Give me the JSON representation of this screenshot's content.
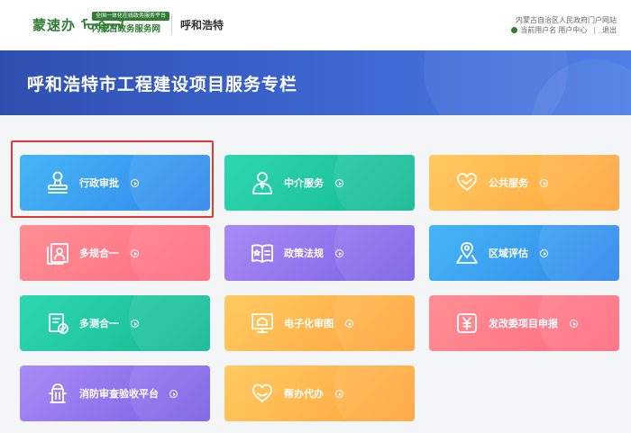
{
  "header": {
    "logo_script": "蒙速办 ᠮᠣᠩᠭᠣᠯ",
    "logo_tag": "全国一体化在线政务服务平台",
    "logo_name": "内蒙古政务服务网",
    "city": "呼和浩特",
    "portal_link": "内蒙古自治区人民政府门户网站",
    "user_label": "当前用户名",
    "user_center": "用户中心",
    "separator": "|",
    "logout": "退出"
  },
  "banner": {
    "title": "呼和浩特市工程建设项目服务专栏"
  },
  "cards": [
    {
      "label": "行政审批",
      "icon": "stamp-icon",
      "color": "blue",
      "highlighted": true
    },
    {
      "label": "中介服务",
      "icon": "agent-icon",
      "color": "green"
    },
    {
      "label": "公共服务",
      "icon": "heart-hands-icon",
      "color": "orange"
    },
    {
      "label": "多规合一",
      "icon": "plan-frame-icon",
      "color": "pink"
    },
    {
      "label": "政策法规",
      "icon": "book-icon",
      "color": "purple"
    },
    {
      "label": "区域评估",
      "icon": "map-pin-icon",
      "color": "blue"
    },
    {
      "label": "多测合一",
      "icon": "survey-icon",
      "color": "green"
    },
    {
      "label": "电子化审图",
      "icon": "monitor-icon",
      "color": "orange"
    },
    {
      "label": "发改委项目申报",
      "icon": "yen-icon",
      "color": "pink"
    },
    {
      "label": "消防审查验收平台",
      "icon": "hydrant-icon",
      "color": "purple"
    },
    {
      "label": "帮办代办",
      "icon": "heart-icon",
      "color": "orange"
    }
  ]
}
